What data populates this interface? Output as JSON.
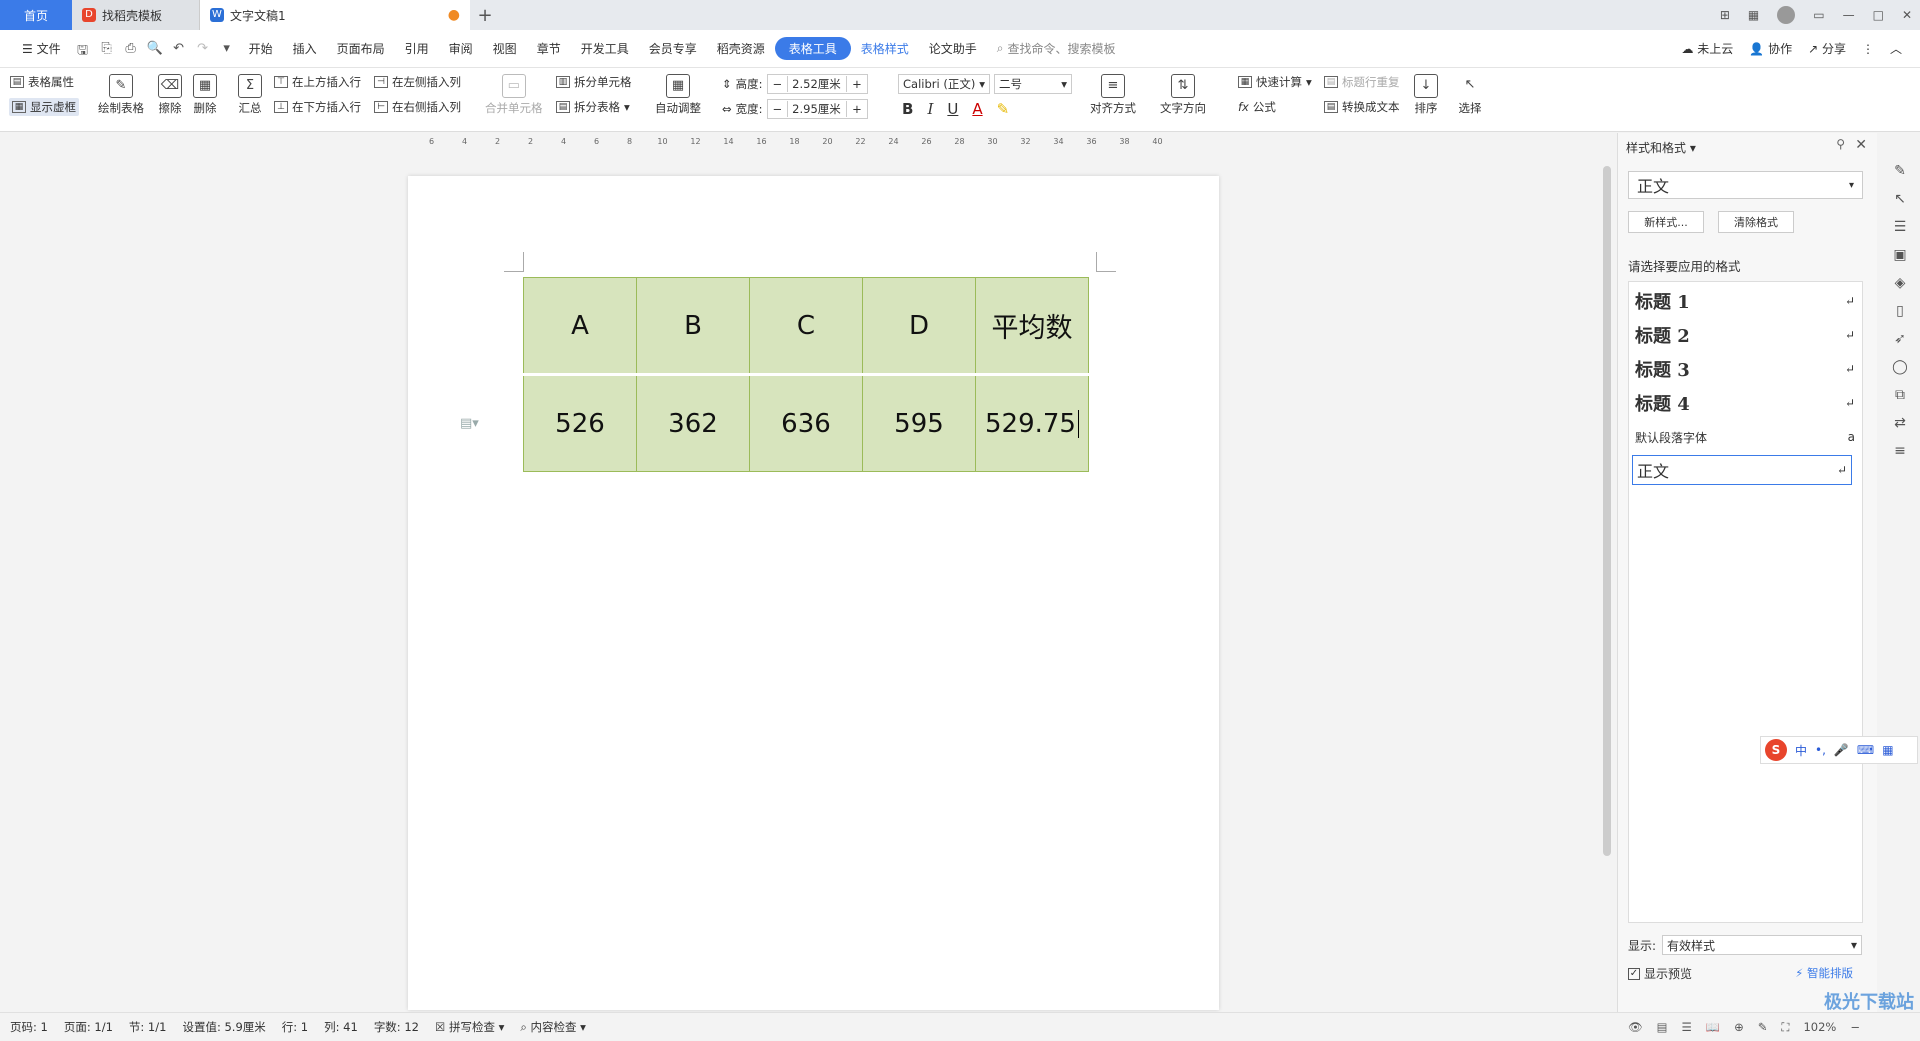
{
  "tabs": [
    {
      "label": "首页"
    },
    {
      "label": "找稻壳模板"
    },
    {
      "label": "文字文稿1"
    }
  ],
  "new_tab": "+",
  "window_controls": [
    "⊞",
    "▭",
    "—",
    "□",
    "✕"
  ],
  "menu": {
    "file": "文件",
    "items": [
      "开始",
      "插入",
      "页面布局",
      "引用",
      "审阅",
      "视图",
      "章节",
      "开发工具",
      "会员专享",
      "稻壳资源"
    ],
    "active": "表格工具",
    "table_style": "表格样式",
    "paper_assistant": "论文助手",
    "search_placeholder": "查找命令、搜索模板",
    "cloud": "未上云",
    "collab": "协作",
    "share": "分享"
  },
  "ribbon": {
    "table_props": "表格属性",
    "show_grid": "显示虚框",
    "draw_table": "绘制表格",
    "erase": "擦除",
    "delete": "删除",
    "summary": "汇总",
    "insert_above": "在上方插入行",
    "insert_below": "在下方插入行",
    "insert_left": "在左侧插入列",
    "insert_right": "在右侧插入列",
    "merge_cells": "合并单元格",
    "split_cells": "拆分单元格",
    "split_table": "拆分表格",
    "auto_fit": "自动调整",
    "height_label": "高度:",
    "height_value": "2.52厘米",
    "width_label": "宽度:",
    "width_value": "2.95厘米",
    "font": "Calibri (正文)",
    "font_size": "二号",
    "quick_calc": "快速计算",
    "title_repeat": "标题行重复",
    "formula": "公式",
    "convert_text": "转换成文本",
    "align": "对齐方式",
    "text_dir": "文字方向",
    "sort": "排序",
    "select": "选择"
  },
  "ruler_ticks": [
    "6",
    "4",
    "2",
    "2",
    "4",
    "6",
    "8",
    "10",
    "12",
    "14",
    "16",
    "18",
    "20",
    "22",
    "24",
    "26",
    "28",
    "30",
    "32",
    "34",
    "36",
    "38",
    "40"
  ],
  "table": {
    "headers": [
      "A",
      "B",
      "C",
      "D",
      "平均数"
    ],
    "row": [
      "526",
      "362",
      "636",
      "595",
      "529.75"
    ]
  },
  "panel": {
    "title": "样式和格式",
    "current_style": "正文",
    "new_style": "新样式...",
    "clear_format": "清除格式",
    "prompt": "请选择要应用的格式",
    "styles": [
      "标题 1",
      "标题 2",
      "标题 3",
      "标题 4"
    ],
    "default_font": "默认段落字体",
    "selected_style": "正文",
    "show_label": "显示:",
    "show_value": "有效样式",
    "preview": "显示预览",
    "smart_layout": "智能排版"
  },
  "ime": {
    "lang": "中",
    "punct": "•,"
  },
  "status": {
    "page": "页码: 1",
    "pages": "页面: 1/1",
    "section": "节: 1/1",
    "setting": "设置值: 5.9厘米",
    "row": "行: 1",
    "col": "列: 41",
    "words": "字数: 12",
    "spell": "拼写检查",
    "content_check": "内容检查",
    "zoom": "102%"
  },
  "watermark": "极光下载站"
}
